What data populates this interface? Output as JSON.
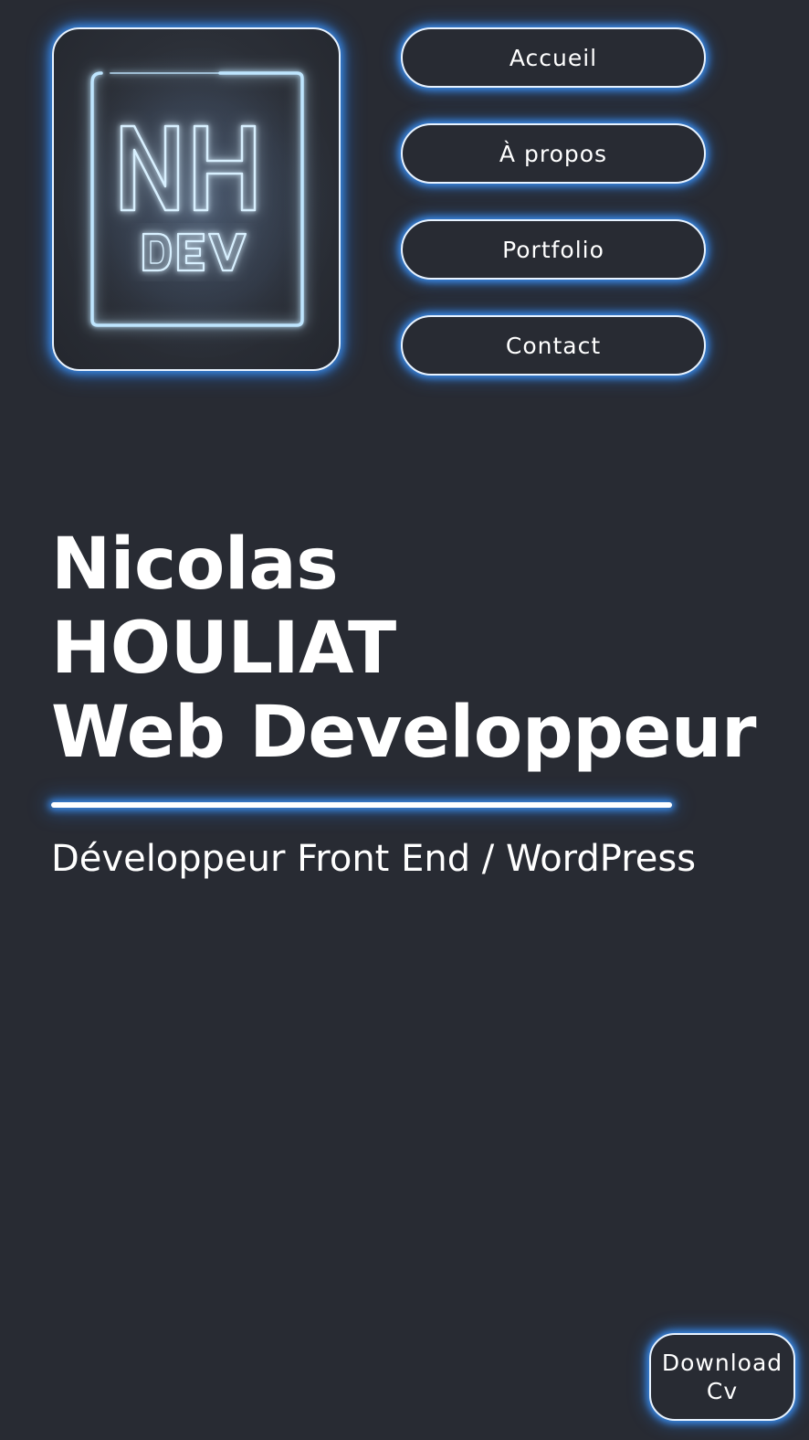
{
  "logo": {
    "line1": "NH",
    "line2": "DEV",
    "icon": "nh-dev-neon-logo"
  },
  "nav": {
    "items": [
      {
        "label": "Accueil"
      },
      {
        "label": "À propos"
      },
      {
        "label": "Portfolio"
      },
      {
        "label": "Contact"
      }
    ]
  },
  "hero": {
    "first_name": "Nicolas",
    "last_name": "HOULIAT",
    "role": "Web Developpeur",
    "subtitle": "Développeur Front End / WordPress"
  },
  "cta": {
    "download_label": "Download Cv"
  },
  "colors": {
    "background": "#282b33",
    "text": "#ffffff",
    "glow": "#3c96ff"
  }
}
